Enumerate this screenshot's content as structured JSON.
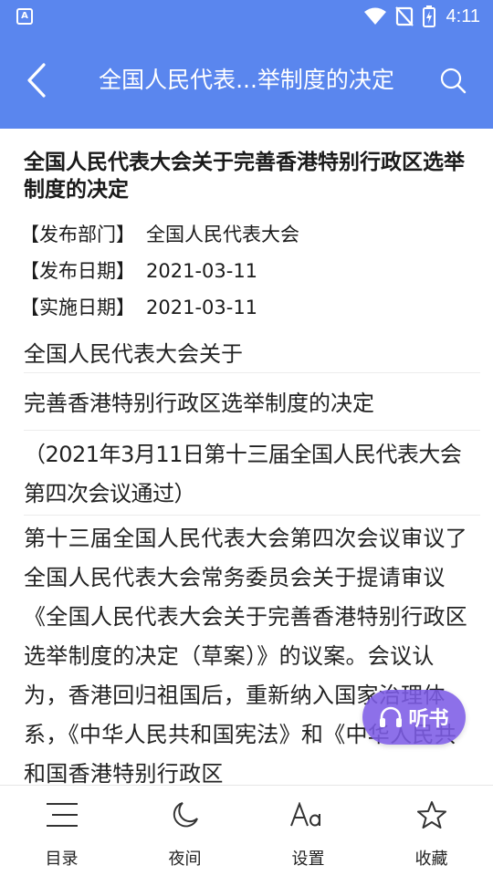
{
  "status_bar": {
    "app_icon_letter": "A",
    "time": "4:11",
    "icons": [
      "wifi-icon",
      "no-signal-icon",
      "battery-charging-icon"
    ]
  },
  "toolbar": {
    "title": "全国人民代表...举制度的决定",
    "back_icon": "chevron-left-icon",
    "search_icon": "search-icon"
  },
  "document": {
    "title": "全国人民代表大会关于完善香港特别行政区选举制度的决定",
    "meta": [
      {
        "label": "【发布部门】",
        "value": "全国人民代表大会"
      },
      {
        "label": "【发布日期】",
        "value": "2021-03-11"
      },
      {
        "label": "【实施日期】",
        "value": "2021-03-11"
      }
    ],
    "paragraphs": [
      "全国人民代表大会关于",
      "完善香港特别行政区选举制度的决定",
      "（2021年3月11日第十三届全国人民代表大会第四次会议通过）",
      "第十三届全国人民代表大会第四次会议审议了全国人民代表大会常务委员会关于提请审议《全国人民代表大会关于完善香港特别行政区选举制度的决定（草案）》的议案。会议认为，香港回归祖国后，重新纳入国家治理体系，《中华人民共和国宪法》和《中华人民共和国香港特别行政区"
    ]
  },
  "listen_button": {
    "label": "听书",
    "icon": "headphones-icon"
  },
  "bottom_nav": [
    {
      "label": "目录",
      "icon": "menu-list-icon"
    },
    {
      "label": "夜间",
      "icon": "moon-icon"
    },
    {
      "label": "设置",
      "icon": "font-size-icon"
    },
    {
      "label": "收藏",
      "icon": "star-icon"
    }
  ],
  "colors": {
    "header": "#5a86ee",
    "listen_button": "#7d5ce6"
  }
}
